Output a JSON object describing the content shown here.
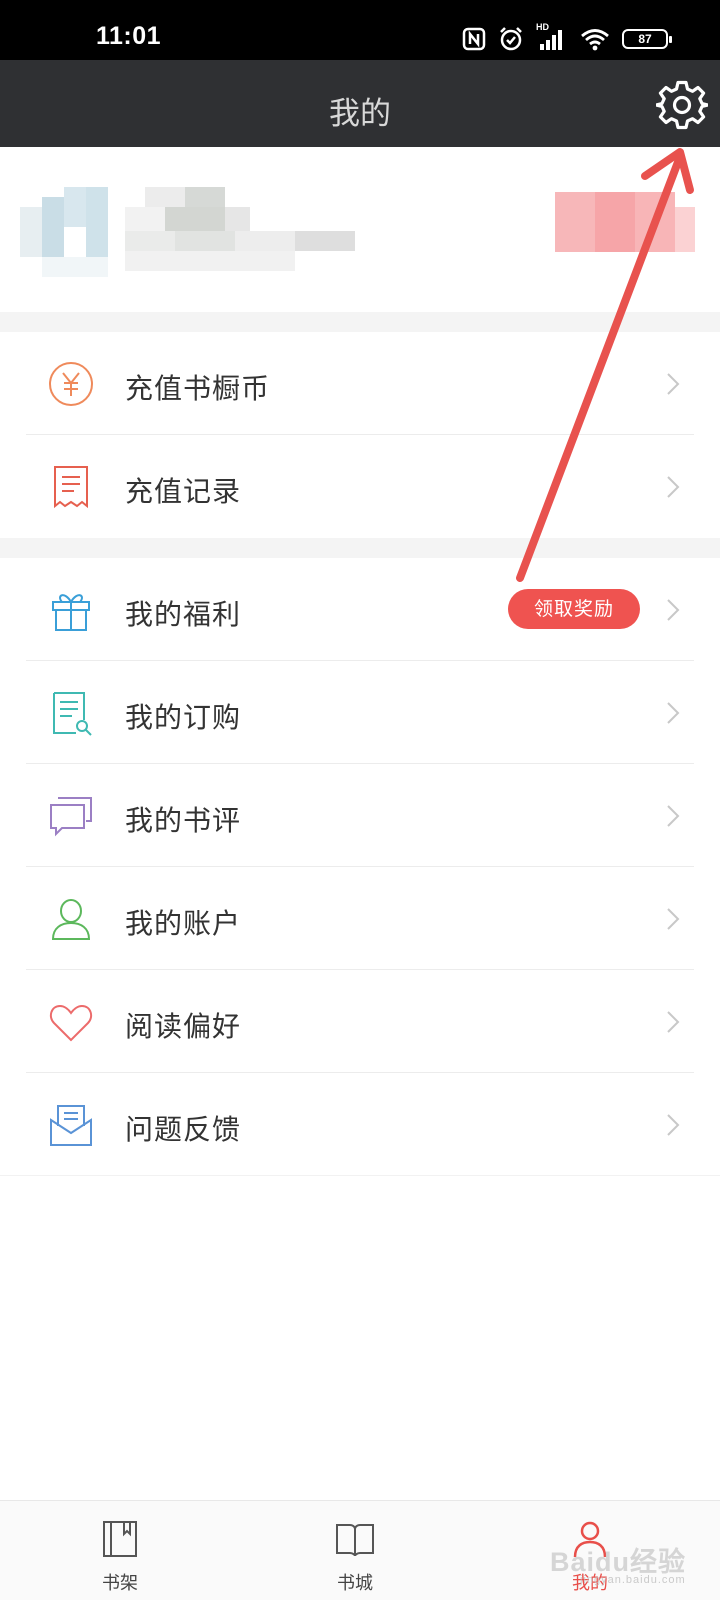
{
  "status_bar": {
    "time": "11:01",
    "battery_level": "87",
    "network_label": "HD"
  },
  "header": {
    "title": "我的",
    "settings_icon": "gear-icon"
  },
  "profile": {
    "avatar": "blurred",
    "name": "blurred",
    "action": "blurred"
  },
  "menu_group_1": [
    {
      "label": "充值书橱币",
      "icon": "yuan-coin-icon",
      "color": "#ef8a5b"
    },
    {
      "label": "充值记录",
      "icon": "receipt-icon",
      "color": "#e6604f"
    }
  ],
  "menu_group_2": [
    {
      "label": "我的福利",
      "icon": "gift-icon",
      "color": "#3a9fd8",
      "badge": "领取奖励"
    },
    {
      "label": "我的订购",
      "icon": "document-search-icon",
      "color": "#3fb9b2"
    },
    {
      "label": "我的书评",
      "icon": "chat-bubbles-icon",
      "color": "#9b7fc4"
    },
    {
      "label": "我的账户",
      "icon": "user-icon",
      "color": "#5cb85c"
    },
    {
      "label": "阅读偏好",
      "icon": "heart-icon",
      "color": "#ec6b6b"
    },
    {
      "label": "问题反馈",
      "icon": "envelope-icon",
      "color": "#5a93d6"
    }
  ],
  "tabs": [
    {
      "label": "书架",
      "icon": "bookshelf-icon",
      "active": false
    },
    {
      "label": "书城",
      "icon": "open-book-icon",
      "active": false
    },
    {
      "label": "我的",
      "icon": "user-tab-icon",
      "active": true
    }
  ],
  "colors": {
    "accent": "#ef5350",
    "nav_bg": "#2f3033",
    "active_tab": "#e84f4a"
  },
  "watermark": {
    "text": "Baidu经验",
    "sub": "jingyan.baidu.com"
  }
}
